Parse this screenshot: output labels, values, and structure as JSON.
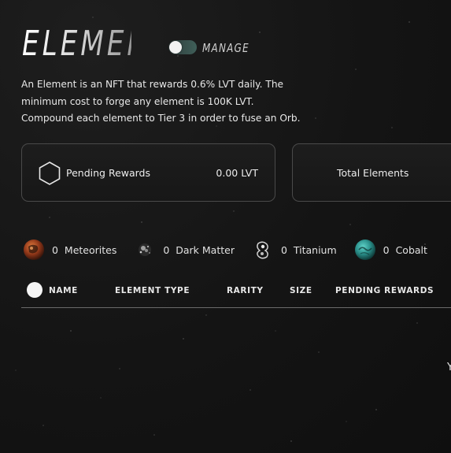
{
  "header": {
    "title": "ELEMENTS",
    "manage_label": "MANAGE"
  },
  "description": "An Element is an NFT that rewards 0.6% LVT daily. The minimum cost to forge any element is 100K LVT. Compound each element to Tier 3 in order to fuse an Orb.",
  "cards": {
    "pending_rewards": {
      "label": "Pending Rewards",
      "value": "0.00 LVT"
    },
    "total_elements": {
      "label": "Total Elements"
    }
  },
  "resources": [
    {
      "name": "Meteorites",
      "count": "0",
      "icon": "meteorite-icon"
    },
    {
      "name": "Dark Matter",
      "count": "0",
      "icon": "dark-matter-icon"
    },
    {
      "name": "Titanium",
      "count": "0",
      "icon": "titanium-icon"
    },
    {
      "name": "Cobalt",
      "count": "0",
      "icon": "cobalt-icon"
    }
  ],
  "table": {
    "columns": [
      "NAME",
      "ELEMENT TYPE",
      "RARITY",
      "SIZE",
      "PENDING REWARDS"
    ]
  },
  "cut_off_text": "Y",
  "colors": {
    "background": "#151515",
    "toggle_accent": "#3f5f59",
    "cobalt": "#2a8f8a",
    "meteorite": "#c0562a"
  }
}
